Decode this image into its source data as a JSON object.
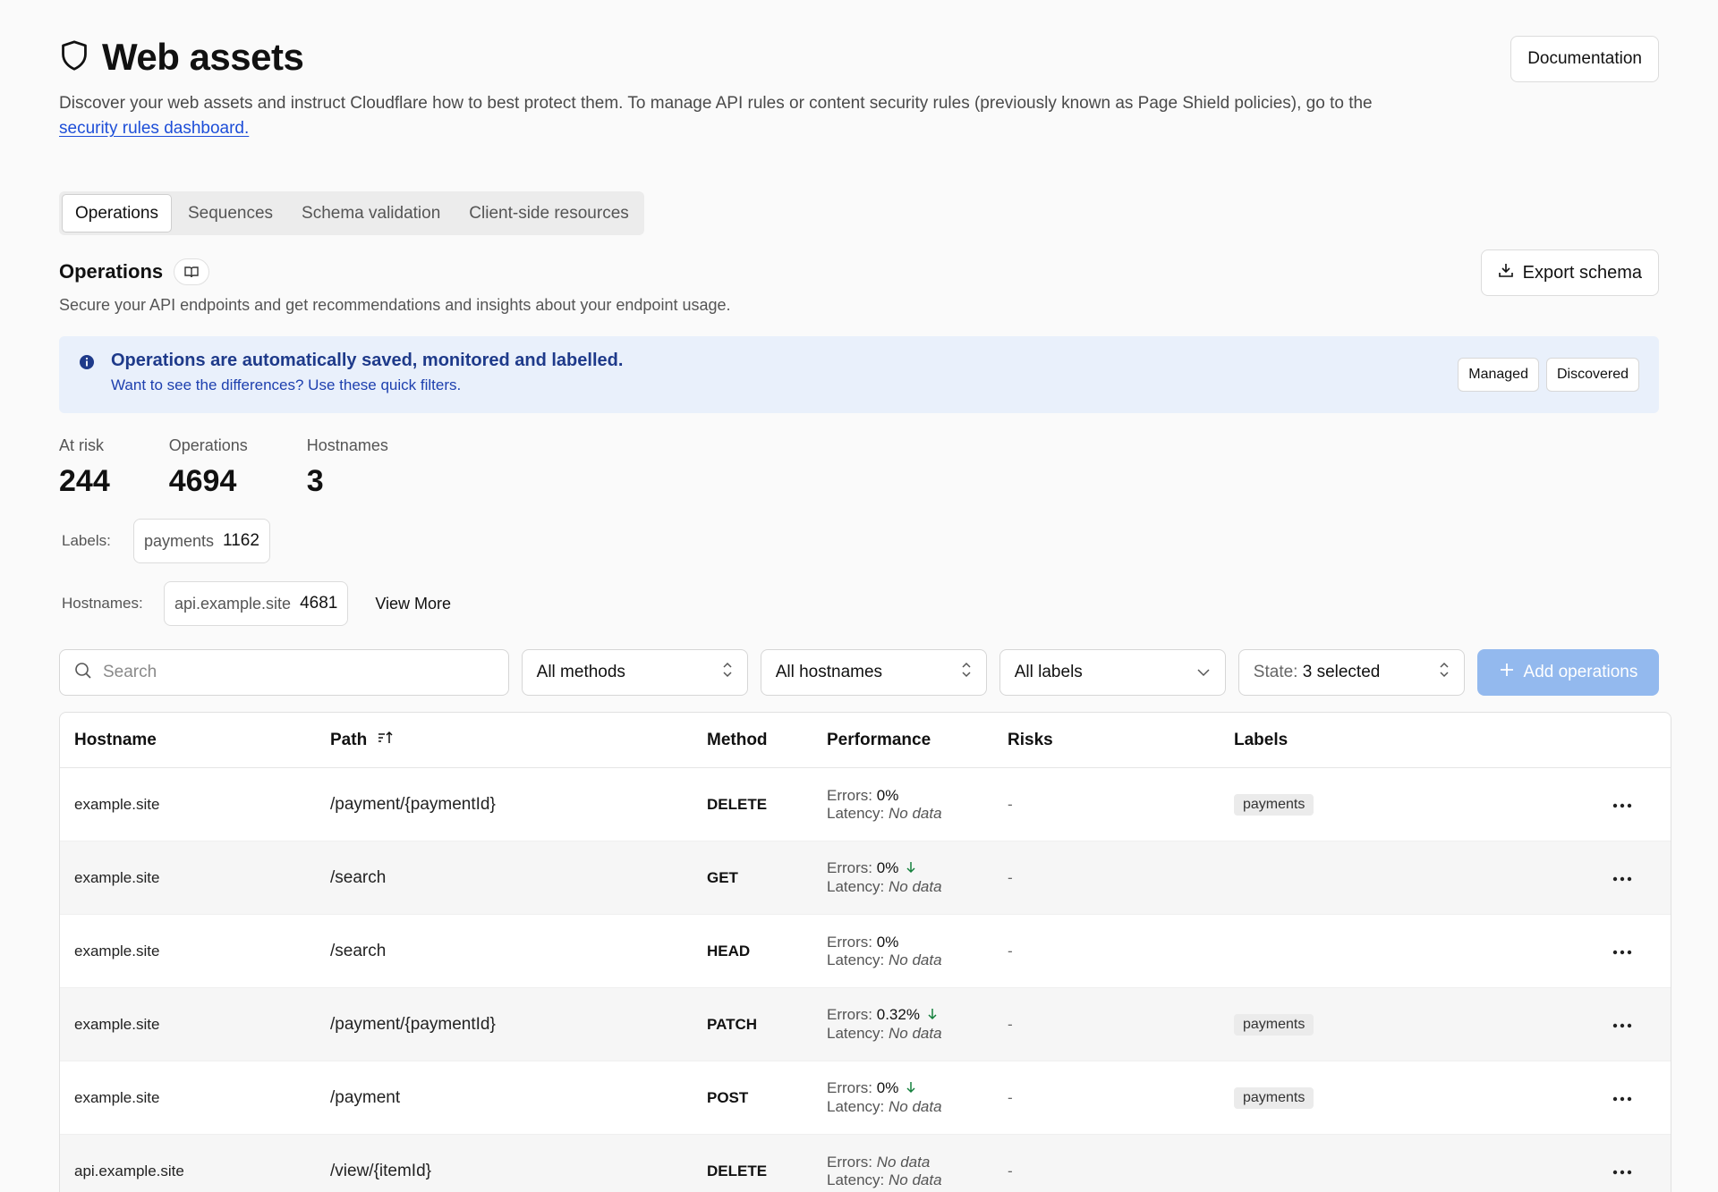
{
  "header": {
    "title": "Web assets",
    "documentation_label": "Documentation",
    "description": "Discover your web assets and instruct Cloudflare how to best protect them. To manage API rules or content security rules (previously known as Page Shield policies), go to the",
    "link_text": "security rules dashboard."
  },
  "tabs": [
    {
      "label": "Operations",
      "active": true
    },
    {
      "label": "Sequences"
    },
    {
      "label": "Schema validation"
    },
    {
      "label": "Client-side resources"
    }
  ],
  "operations": {
    "title": "Operations",
    "subtitle": "Secure your API endpoints and get recommendations and insights about your endpoint usage.",
    "export_label": "Export schema"
  },
  "banner": {
    "title": "Operations are automatically saved, monitored and labelled.",
    "subtitle": "Want to see the differences? Use these quick filters.",
    "managed_label": "Managed",
    "discovered_label": "Discovered"
  },
  "stats": [
    {
      "label": "At risk",
      "value": "244"
    },
    {
      "label": "Operations",
      "value": "4694"
    },
    {
      "label": "Hostnames",
      "value": "3"
    }
  ],
  "labels_filter": {
    "key": "Labels:",
    "items": [
      {
        "name": "payments",
        "count": "1162"
      }
    ]
  },
  "hostnames_filter": {
    "key": "Hostnames:",
    "items": [
      {
        "name": "api.example.site",
        "count": "4681"
      }
    ],
    "view_more": "View More"
  },
  "toolbar": {
    "search_placeholder": "Search",
    "methods": "All methods",
    "hostnames": "All hostnames",
    "labels": "All labels",
    "state_key": "State:",
    "state_value": "3 selected",
    "add_label": "Add operations"
  },
  "table": {
    "headers": {
      "hostname": "Hostname",
      "path": "Path",
      "method": "Method",
      "performance": "Performance",
      "risks": "Risks",
      "labels": "Labels"
    },
    "errors_key": "Errors:",
    "latency_key": "Latency:",
    "rows": [
      {
        "hostname": "example.site",
        "path": "/payment/{paymentId}",
        "method": "DELETE",
        "errors": "0%",
        "latency": "No data",
        "risks": "-",
        "label": "payments",
        "arrow": false
      },
      {
        "hostname": "example.site",
        "path": "/search",
        "method": "GET",
        "errors": "0%",
        "latency": "No data",
        "risks": "-",
        "label": "",
        "arrow": true
      },
      {
        "hostname": "example.site",
        "path": "/search",
        "method": "HEAD",
        "errors": "0%",
        "latency": "No data",
        "risks": "-",
        "label": "",
        "arrow": false
      },
      {
        "hostname": "example.site",
        "path": "/payment/{paymentId}",
        "method": "PATCH",
        "errors": "0.32%",
        "latency": "No data",
        "risks": "-",
        "label": "payments",
        "arrow": true
      },
      {
        "hostname": "example.site",
        "path": "/payment",
        "method": "POST",
        "errors": "0%",
        "latency": "No data",
        "risks": "-",
        "label": "payments",
        "arrow": true
      },
      {
        "hostname": "api.example.site",
        "path": "/view/{itemId}",
        "method": "DELETE",
        "errors": "No data",
        "latency": "No data",
        "risks": "-",
        "label": "",
        "arrow": false
      }
    ]
  }
}
